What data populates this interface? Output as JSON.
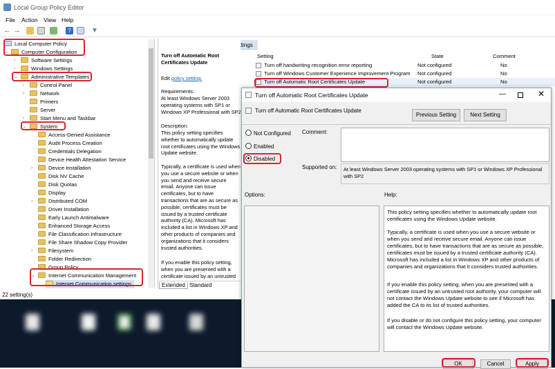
{
  "window": {
    "title": "Local Group Policy Editor"
  },
  "menu": [
    "File",
    "Action",
    "View",
    "Help"
  ],
  "tree": [
    {
      "label": "Local Computer Policy"
    },
    {
      "label": "Computer Configuration"
    },
    {
      "label": "Software Settings"
    },
    {
      "label": "Windows Settings"
    },
    {
      "label": "Administrative Templates"
    },
    {
      "label": "Control Panel"
    },
    {
      "label": "Network"
    },
    {
      "label": "Printers"
    },
    {
      "label": "Server"
    },
    {
      "label": "Start Menu and Taskbar"
    },
    {
      "label": "System"
    },
    {
      "label": "Access-Denied Assistance"
    },
    {
      "label": "Audit Process Creation"
    },
    {
      "label": "Credentials Delegation"
    },
    {
      "label": "Device Health Attestation Service"
    },
    {
      "label": "Device Installation"
    },
    {
      "label": "Disk NV Cache"
    },
    {
      "label": "Disk Quotas"
    },
    {
      "label": "Display"
    },
    {
      "label": "Distributed COM"
    },
    {
      "label": "Driver Installation"
    },
    {
      "label": "Early Launch Antimalware"
    },
    {
      "label": "Enhanced Storage Access"
    },
    {
      "label": "File Classification Infrastructure"
    },
    {
      "label": "File Share Shadow Copy Provider"
    },
    {
      "label": "Filesystem"
    },
    {
      "label": "Folder Redirection"
    },
    {
      "label": "Group Policy"
    },
    {
      "label": "Internet Communication Management"
    },
    {
      "label": "Internet Communication settings"
    }
  ],
  "status": "22 setting(s)",
  "header_tab": "Internet Communication settings",
  "description": {
    "title": "Turn off Automatic Root Certificates Update",
    "edit_prefix": "Edit ",
    "edit_link": "policy setting.",
    "requirements_label": "Requirements:",
    "requirements": "At least Windows Server 2003 operating systems with SP1 or Windows XP Professional with SP2",
    "description_label": "Description:",
    "p1": "This policy setting specifies whether to automatically update root certificates using the Windows Update website.",
    "p2": "Typically, a certificate is used when you use a secure website or when you send and receive secure email. Anyone can issue certificates, but to have transactions that are as secure as possible, certificates must be issued by a trusted certificate authority (CA). Microsoft has included a list in Windows XP and other products of companies and organizations that it considers trusted authorities.",
    "p3": "If you enable this policy setting, when you are presented with a certificate issued by an untrusted"
  },
  "tabs": [
    "Extended",
    "Standard"
  ],
  "settings_table": {
    "headers": [
      "Setting",
      "State",
      "Comment"
    ],
    "rows": [
      {
        "setting": "Turn off handwriting recognition error reporting",
        "state": "Not configured",
        "comment": "No"
      },
      {
        "setting": "Turn off Windows Customer Experience Improvement Program",
        "state": "Not configured",
        "comment": "No"
      },
      {
        "setting": "Turn off Automatic Root Certificates Update",
        "state": "Not configured",
        "comment": "No"
      }
    ]
  },
  "dialog": {
    "title": "Turn off Automatic Root Certificates Update",
    "subtitle": "Turn off Automatic Root Certificates Update",
    "prev_button": "Previous Setting",
    "next_button": "Next Setting",
    "options": [
      "Not Configured",
      "Enabled",
      "Disabled"
    ],
    "selected": "Disabled",
    "comment_label": "Comment:",
    "supported_label": "Supported on:",
    "supported_text": "At least Windows Server 2003 operating systems with SP1 or Windows XP Professional with SP2",
    "options_label": "Options:",
    "help_label": "Help:",
    "help_p1": "This policy setting specifies whether to automatically update root certificates using the Windows Update website.",
    "help_p2": "Typically, a certificate is used when you use a secure website or when you send and receive secure email. Anyone can issue certificates, but to have transactions that are as secure as possible, certificates must be issued by a trusted certificate authority (CA). Microsoft has included a list in Windows XP and other products of companies and organizations that it considers trusted authorities.",
    "help_p3": "If you enable this policy setting, when you are presented with a certificate issued by an untrusted root authority, your computer will not contact the Windows Update website to see if Microsoft has added the CA to its list of trusted authorities.",
    "help_p4": "If you disable or do not configure this policy setting, your computer will contact the Windows Update website.",
    "ok": "OK",
    "cancel": "Cancel",
    "apply": "Apply"
  },
  "colors": {
    "highlight": "#d9232e",
    "selection": "#cce4f7",
    "taskbar": "#0d1a2c"
  }
}
